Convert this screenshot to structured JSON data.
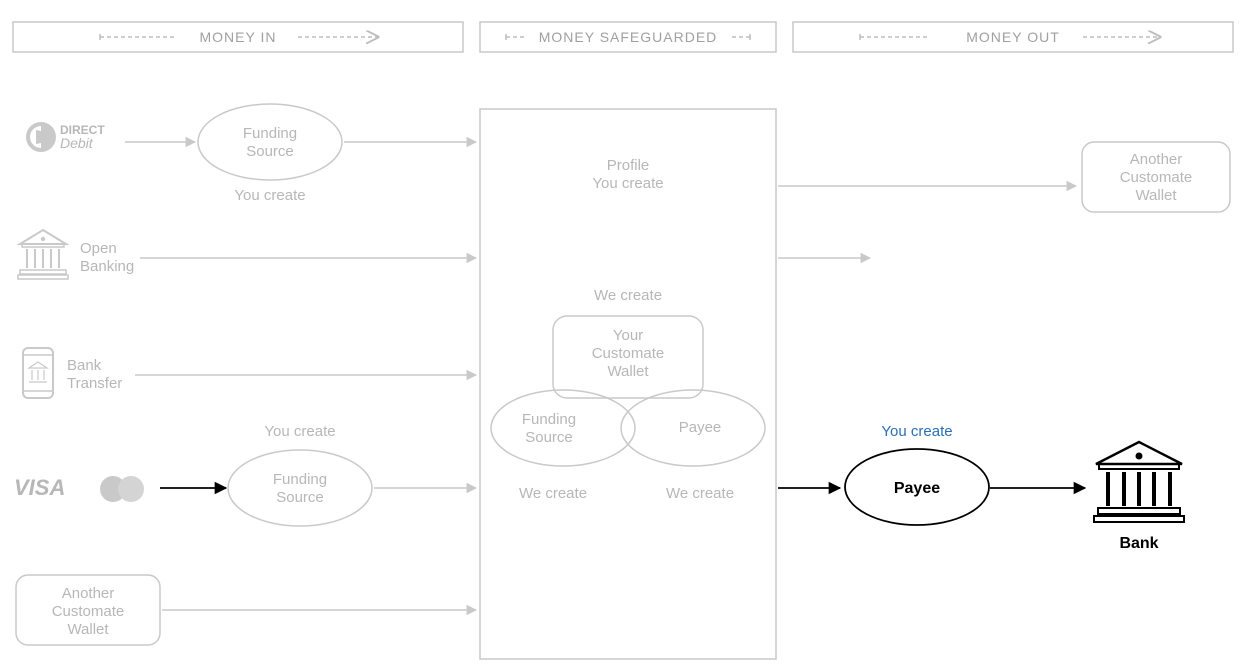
{
  "headers": {
    "money_in": "MONEY IN",
    "money_safeguarded": "MONEY SAFEGUARDED",
    "money_out": "MONEY OUT"
  },
  "inputs": {
    "direct_debit_label1": "DIRECT",
    "direct_debit_label2": "Debit",
    "open_banking_line1": "Open",
    "open_banking_line2": "Banking",
    "bank_transfer_line1": "Bank",
    "bank_transfer_line2": "Transfer",
    "visa": "VISA",
    "another_wallet_line1": "Another",
    "another_wallet_line2": "Customate",
    "another_wallet_line3": "Wallet"
  },
  "funding_source": {
    "label_line1": "Funding",
    "label_line2": "Source",
    "you_create": "You create"
  },
  "center": {
    "profile": "Profile",
    "profile_sub": "You create",
    "we_create": "We create",
    "your_wallet_line1": "Your",
    "your_wallet_line2": "Customate",
    "your_wallet_line3": "Wallet",
    "funding_source_line1": "Funding",
    "funding_source_line2": "Source",
    "payee": "Payee"
  },
  "output": {
    "another_wallet_line1": "Another",
    "another_wallet_line2": "Customate",
    "another_wallet_line3": "Wallet",
    "payee_you_create": "You create",
    "payee_label": "Payee",
    "bank_label": "Bank"
  }
}
